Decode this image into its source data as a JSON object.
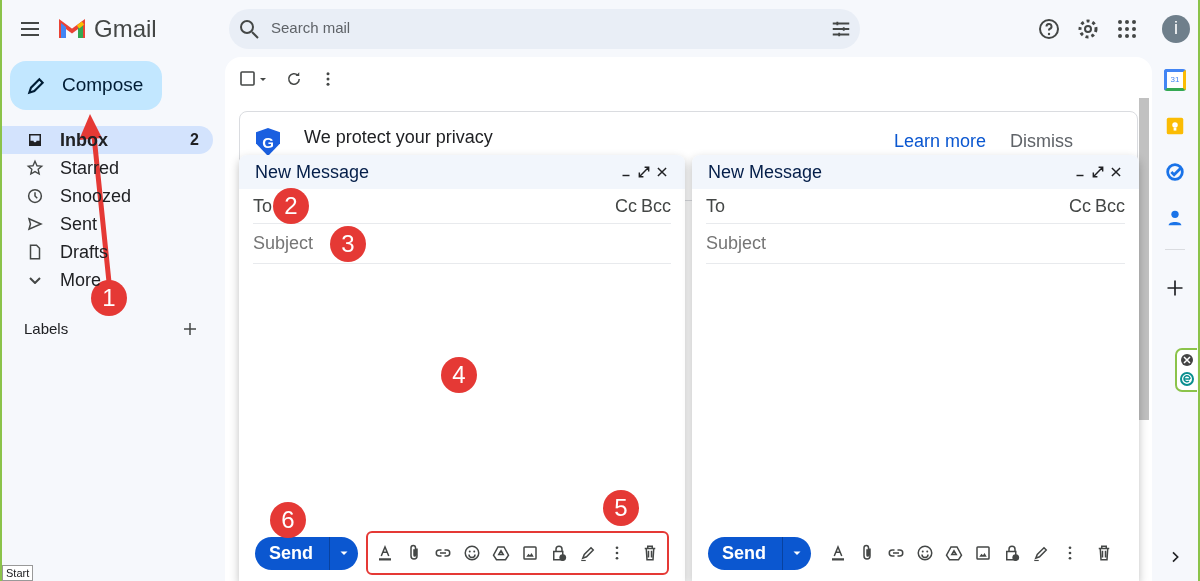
{
  "header": {
    "app_name": "Gmail",
    "search": {
      "placeholder": "Search mail"
    },
    "avatar": "i"
  },
  "sidebar": {
    "compose": "Compose",
    "items": [
      {
        "label": "Inbox",
        "count": "2",
        "selected": true
      },
      {
        "label": "Starred",
        "selected": false
      },
      {
        "label": "Snoozed",
        "selected": false
      },
      {
        "label": "Sent",
        "selected": false
      },
      {
        "label": "Drafts",
        "selected": false
      },
      {
        "label": "More",
        "selected": false
      }
    ],
    "labels_heading": "Labels"
  },
  "banner": {
    "shield_letter": "G",
    "title": "We protect your privacy",
    "learn_more": "Learn more",
    "dismiss": "Dismiss"
  },
  "compose_windows": [
    {
      "title": "New Message",
      "to": "To",
      "cc": "Cc",
      "bcc": "Bcc",
      "subject_placeholder": "Subject",
      "send": "Send",
      "toolbar_highlighted": true
    },
    {
      "title": "New Message",
      "to": "To",
      "cc": "Cc",
      "bcc": "Bcc",
      "subject_placeholder": "Subject",
      "send": "Send",
      "toolbar_highlighted": false
    }
  ],
  "annotations": [
    {
      "number": "1"
    },
    {
      "number": "2"
    },
    {
      "number": "3"
    },
    {
      "number": "4"
    },
    {
      "number": "5"
    },
    {
      "number": "6"
    }
  ],
  "rail": {
    "calendar_day": "31"
  },
  "taskbar": {
    "start": "Start"
  }
}
